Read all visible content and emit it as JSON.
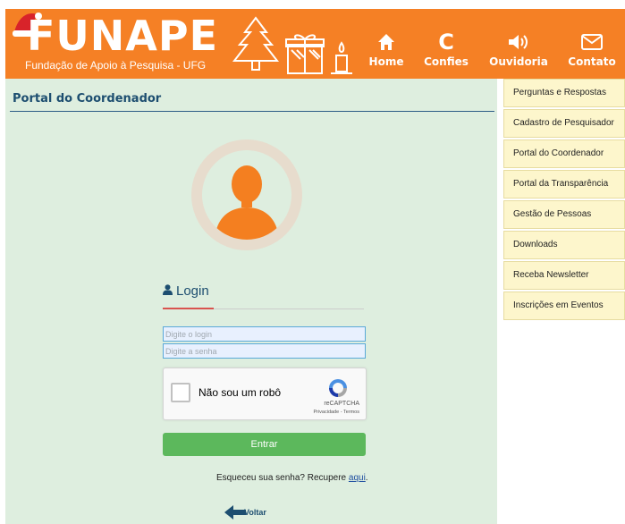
{
  "header": {
    "logo": "FUNAPE",
    "subtitle": "Fundação de Apoio à Pesquisa - UFG",
    "nav": [
      {
        "label": "Home",
        "icon": "home-icon"
      },
      {
        "label": "Confies",
        "icon": "confies-c-icon"
      },
      {
        "label": "Ouvidoria",
        "icon": "speaker-icon"
      },
      {
        "label": "Contato",
        "icon": "envelope-icon"
      }
    ],
    "background_color": "#f58025"
  },
  "main": {
    "title": "Portal do Coordenador",
    "background_color": "#deeedf",
    "login": {
      "heading": "Login",
      "login_placeholder": "Digite o login",
      "password_placeholder": "Digite a senha",
      "captcha_label": "Não sou um robô",
      "captcha_brand": "reCAPTCHA",
      "captcha_links": "Privacidade - Termos",
      "submit_label": "Entrar",
      "forgot_text": "Esqueceu sua senha? Recupere ",
      "forgot_link": "aqui",
      "forgot_end": ".",
      "back_label": "Voltar"
    }
  },
  "sidebar": {
    "items": [
      {
        "label": "Perguntas e Respostas"
      },
      {
        "label": "Cadastro de Pesquisador"
      },
      {
        "label": "Portal do Coordenador"
      },
      {
        "label": "Portal da Transparência"
      },
      {
        "label": "Gestão de Pessoas"
      },
      {
        "label": "Downloads"
      },
      {
        "label": "Receba Newsletter"
      },
      {
        "label": "Inscrições em Eventos"
      }
    ],
    "background_color": "#fdf6cc"
  },
  "colors": {
    "accent_orange": "#f58025",
    "title_blue": "#1d4e70",
    "button_green": "#5cb85c"
  }
}
